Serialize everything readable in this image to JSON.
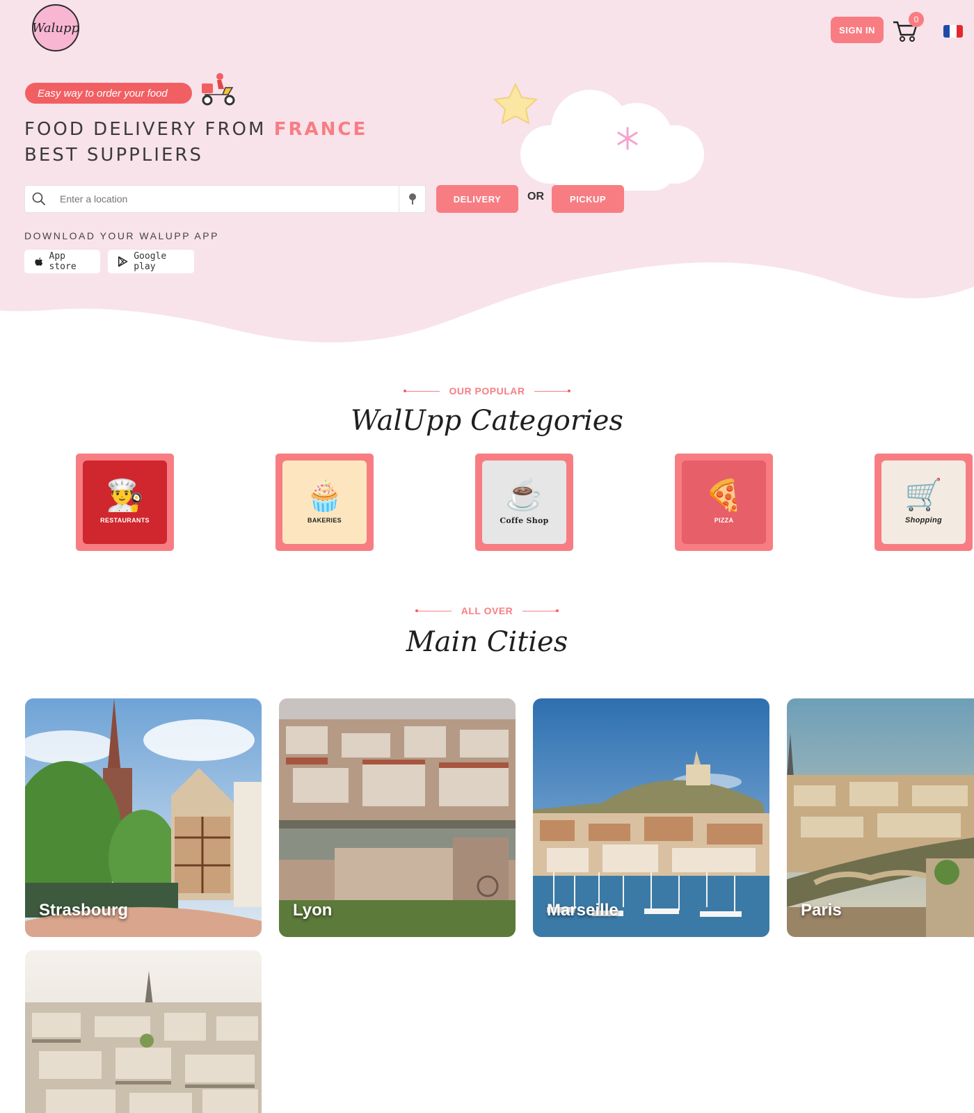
{
  "header": {
    "logo_text": "Walupp",
    "signin_label": "SIGN IN",
    "cart_count": "0",
    "language": "fr",
    "flag_colors": [
      "#1f4aa8",
      "#ffffff",
      "#e4282f"
    ]
  },
  "hero": {
    "tagline": "Easy way to order your food",
    "headline_before": "FOOD DELIVERY FROM",
    "headline_accent": "FRANCE",
    "headline_after": "BEST SUPPLIERS",
    "search_placeholder": "Enter a location",
    "delivery_label": "DELIVERY",
    "or_label": "OR",
    "pickup_label": "PICKUP",
    "download_label": "DOWNLOAD YOUR WALUPP APP",
    "app_store_label": "App store",
    "google_play_label": "Google play"
  },
  "categories": {
    "kicker": "OUR POPULAR",
    "title": "WalUpp Categories",
    "items": [
      {
        "label": "RESTAURANTS",
        "icon": "chef-icon",
        "bg": "#d0262e",
        "fg": "#ffffff"
      },
      {
        "label": "BAKERIES",
        "icon": "cupcake-icon",
        "bg": "#fde6bf",
        "fg": "#222222"
      },
      {
        "label": "Coffe Shop",
        "icon": "coffee-cup-icon",
        "bg": "#e6e6e6",
        "fg": "#222222"
      },
      {
        "label": "PIZZA",
        "icon": "pizza-chef-icon",
        "bg": "#e65f69",
        "fg": "#ffffff"
      },
      {
        "label": "Shopping",
        "icon": "shopping-cart-icon",
        "bg": "#f3ebe1",
        "fg": "#222222"
      }
    ]
  },
  "cities": {
    "kicker": "ALL OVER",
    "title": "Main Cities",
    "items": [
      {
        "name": "Strasbourg"
      },
      {
        "name": "Lyon"
      },
      {
        "name": "Marseille"
      },
      {
        "name": "Paris"
      },
      {
        "name": ""
      }
    ]
  },
  "colors": {
    "accent": "#f87d83",
    "hero_bg": "#f8e3ea",
    "pill": "#f25f63"
  }
}
